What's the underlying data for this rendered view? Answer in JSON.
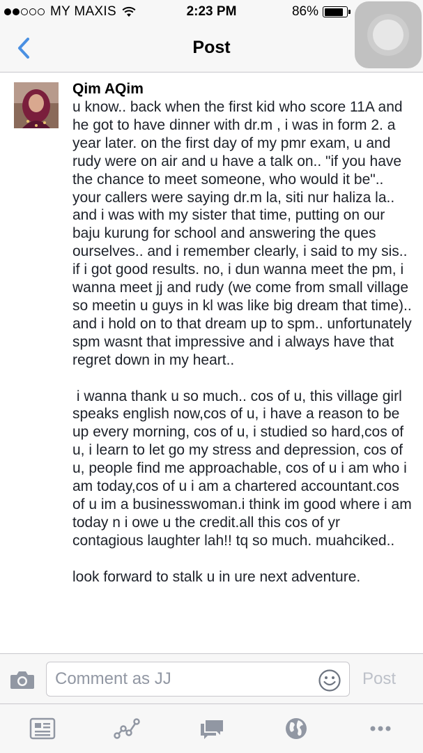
{
  "status_bar": {
    "carrier": "MY MAXIS",
    "time": "2:23 PM",
    "battery_percent": "86%",
    "battery_level": 0.86,
    "signal_bars_filled": 2,
    "signal_bars_total": 5
  },
  "nav": {
    "title": "Post",
    "back_icon": "chevron-left-icon"
  },
  "post": {
    "author": "Qim AQim",
    "body": "u know.. back when the first kid who score 11A and he got to have dinner with dr.m , i was in form 2. a year later. on the first day of my pmr exam, u and rudy were on air and u have a talk on.. \"if you have the chance to meet someone, who would it be\".. your callers were saying dr.m la, siti nur haliza la.. and i was with my sister that time, putting on our baju kurung for school and answering the ques ourselves.. and i remember clearly, i said to my sis.. if i got good results. no, i dun wanna meet the pm, i wanna meet jj and rudy (we come from small village so meetin u guys in kl was like big dream that time).. and i hold on to that dream up to spm.. unfortunately spm wasnt that impressive and i always have that regret down in my heart..\n\n i wanna thank u so much.. cos of u, this village girl speaks english now,cos of u, i have a reason to be up every morning, cos of u, i studied so hard,cos of u, i learn to let go my stress and depression, cos of u, people find me approachable, cos of u i am who i am today,cos of u i am a chartered accountant.cos of u im a businesswoman.i think im good where i am today n i owe u the credit.all this cos of yr contagious laughter lah!! tq so much. muahciked..\n\nlook forward to stalk u in ure next adventure."
  },
  "comment_bar": {
    "placeholder": "Comment as JJ",
    "post_label": "Post"
  },
  "tab_bar": {
    "items": [
      "news-feed-icon",
      "activity-icon",
      "messages-icon",
      "globe-icon",
      "more-icon"
    ]
  },
  "colors": {
    "accent": "#4a90e2",
    "bar_bg": "#f7f7f7",
    "icon_gray": "#9197a3",
    "post_disabled": "#bdc1c9"
  }
}
